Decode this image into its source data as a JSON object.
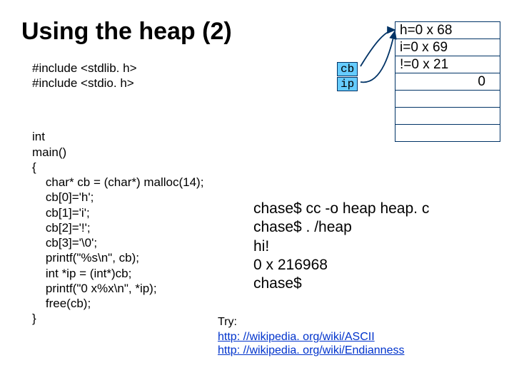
{
  "title": "Using the heap (2)",
  "includes": {
    "l1": "#include <stdlib. h>",
    "l2": "#include <stdio. h>"
  },
  "code": {
    "l1": "int",
    "l2": "main()",
    "l3": "{",
    "l4": "    char* cb = (char*) malloc(14);",
    "l5": "    cb[0]='h';",
    "l6": "    cb[1]='i';",
    "l7": "    cb[2]='!';",
    "l8": "    cb[3]='\\0';",
    "l9": "    printf(\"%s\\n\", cb);",
    "l10": "    int *ip = (int*)cb;",
    "l11": "    printf(\"0 x%x\\n\", *ip);",
    "l12": "    free(cb);",
    "l13": "}"
  },
  "pointers": {
    "cb": "cb",
    "ip": "ip"
  },
  "memory": {
    "r0": "h=0 x 68",
    "r1": "i=0 x 69",
    "r2": "!=0 x 21",
    "r3": "0",
    "r4": "",
    "r5": "",
    "r6": ""
  },
  "terminal": {
    "l1": "chase$ cc -o heap heap. c",
    "l2": "chase$ . /heap",
    "l3": "hi!",
    "l4": "0 x 216968",
    "l5": "chase$"
  },
  "try_label": "Try:",
  "links": {
    "ascii_text": "http: //wikipedia. org/wiki/ASCII",
    "ascii_href": "http://wikipedia.org/wiki/ASCII",
    "endian_text": "http: //wikipedia. org/wiki/Endianness",
    "endian_href": "http://wikipedia.org/wiki/Endianness"
  }
}
